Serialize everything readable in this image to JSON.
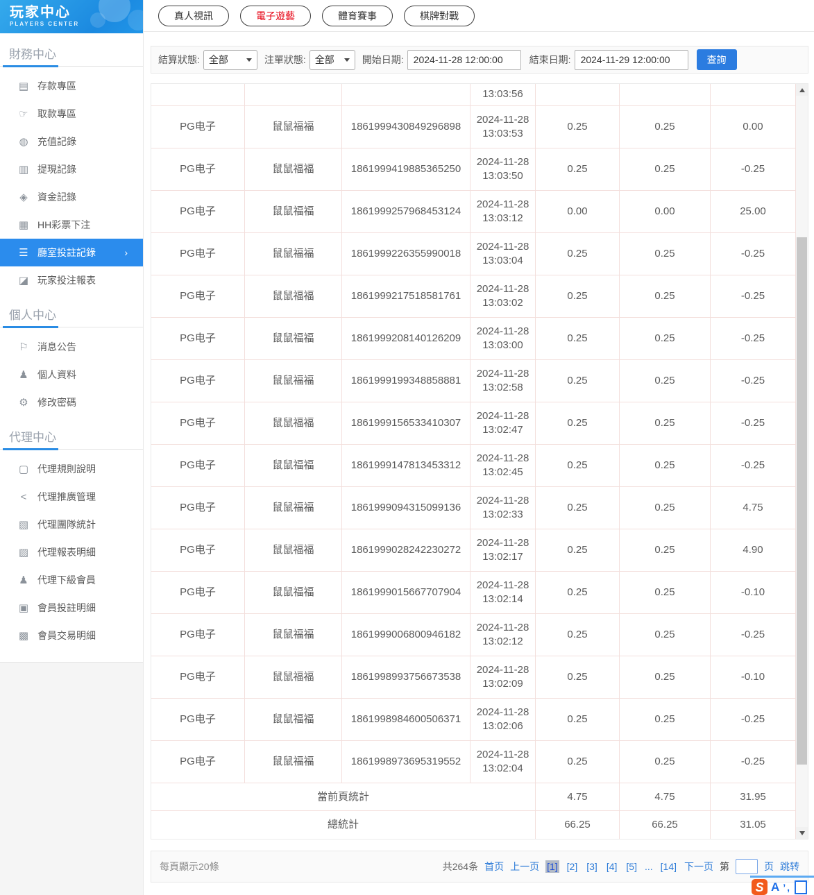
{
  "header": {
    "title": "玩家中心",
    "subtitle": "PLAYERS CENTER"
  },
  "sidebar": {
    "sections": [
      {
        "title": "財務中心",
        "items": [
          {
            "label": "存款專區",
            "icon": "deposit-icon",
            "glyph": "▤",
            "active": false
          },
          {
            "label": "取款專區",
            "icon": "withdraw-area-icon",
            "glyph": "☞",
            "active": false
          },
          {
            "label": "充值記錄",
            "icon": "recharge-record-icon",
            "glyph": "◍",
            "active": false
          },
          {
            "label": "提現記錄",
            "icon": "withdraw-record-icon",
            "glyph": "▥",
            "active": false
          },
          {
            "label": "資金記錄",
            "icon": "funds-record-icon",
            "glyph": "◈",
            "active": false
          },
          {
            "label": "HH彩票下注",
            "icon": "lottery-bet-icon",
            "glyph": "▦",
            "active": false
          },
          {
            "label": "廳室投註記錄",
            "icon": "hall-bet-record-icon",
            "glyph": "☰",
            "active": true,
            "chevron": "›"
          },
          {
            "label": "玩家投注報表",
            "icon": "player-bet-report-icon",
            "glyph": "◪",
            "active": false
          }
        ]
      },
      {
        "title": "個人中心",
        "items": [
          {
            "label": "消息公告",
            "icon": "bell-icon",
            "glyph": "⚐",
            "active": false
          },
          {
            "label": "個人資料",
            "icon": "user-icon",
            "glyph": "♟",
            "active": false
          },
          {
            "label": "修改密碼",
            "icon": "gear-icon",
            "glyph": "⚙",
            "active": false
          }
        ]
      },
      {
        "title": "代理中心",
        "items": [
          {
            "label": "代理規則說明",
            "icon": "doc-icon",
            "glyph": "▢",
            "active": false
          },
          {
            "label": "代理推廣管理",
            "icon": "share-icon",
            "glyph": "<",
            "active": false
          },
          {
            "label": "代理團隊統計",
            "icon": "team-stats-icon",
            "glyph": "▧",
            "active": false
          },
          {
            "label": "代理報表明細",
            "icon": "report-detail-icon",
            "glyph": "▨",
            "active": false
          },
          {
            "label": "代理下級會員",
            "icon": "members-icon",
            "glyph": "♟",
            "active": false
          },
          {
            "label": "會員投註明細",
            "icon": "member-bet-detail-icon",
            "glyph": "▣",
            "active": false
          },
          {
            "label": "會員交易明細",
            "icon": "member-trade-detail-icon",
            "glyph": "▩",
            "active": false
          }
        ]
      }
    ]
  },
  "tabs": [
    {
      "label": "真人視訊",
      "active": false
    },
    {
      "label": "電子遊藝",
      "active": true
    },
    {
      "label": "體育賽事",
      "active": false
    },
    {
      "label": "棋牌對戰",
      "active": false
    }
  ],
  "filters": {
    "settle_label": "結算狀態:",
    "settle_value": "全部",
    "order_label": "注單狀態:",
    "order_value": "全部",
    "start_label": "開始日期:",
    "start_value": "2024-11-28 12:00:00",
    "end_label": "結束日期:",
    "end_value": "2024-11-29 12:00:00",
    "search_label": "查詢"
  },
  "table": {
    "partial_row_time": "13:03:56",
    "rows": [
      {
        "platform": "PG电子",
        "game": "鼠鼠福福",
        "order": "1861999430849296898",
        "date": "2024-11-28",
        "time": "13:03:53",
        "bet": "0.25",
        "valid": "0.25",
        "profit": "0.00"
      },
      {
        "platform": "PG电子",
        "game": "鼠鼠福福",
        "order": "1861999419885365250",
        "date": "2024-11-28",
        "time": "13:03:50",
        "bet": "0.25",
        "valid": "0.25",
        "profit": "-0.25"
      },
      {
        "platform": "PG电子",
        "game": "鼠鼠福福",
        "order": "1861999257968453124",
        "date": "2024-11-28",
        "time": "13:03:12",
        "bet": "0.00",
        "valid": "0.00",
        "profit": "25.00"
      },
      {
        "platform": "PG电子",
        "game": "鼠鼠福福",
        "order": "1861999226355990018",
        "date": "2024-11-28",
        "time": "13:03:04",
        "bet": "0.25",
        "valid": "0.25",
        "profit": "-0.25"
      },
      {
        "platform": "PG电子",
        "game": "鼠鼠福福",
        "order": "1861999217518581761",
        "date": "2024-11-28",
        "time": "13:03:02",
        "bet": "0.25",
        "valid": "0.25",
        "profit": "-0.25"
      },
      {
        "platform": "PG电子",
        "game": "鼠鼠福福",
        "order": "1861999208140126209",
        "date": "2024-11-28",
        "time": "13:03:00",
        "bet": "0.25",
        "valid": "0.25",
        "profit": "-0.25"
      },
      {
        "platform": "PG电子",
        "game": "鼠鼠福福",
        "order": "1861999199348858881",
        "date": "2024-11-28",
        "time": "13:02:58",
        "bet": "0.25",
        "valid": "0.25",
        "profit": "-0.25"
      },
      {
        "platform": "PG电子",
        "game": "鼠鼠福福",
        "order": "1861999156533410307",
        "date": "2024-11-28",
        "time": "13:02:47",
        "bet": "0.25",
        "valid": "0.25",
        "profit": "-0.25"
      },
      {
        "platform": "PG电子",
        "game": "鼠鼠福福",
        "order": "1861999147813453312",
        "date": "2024-11-28",
        "time": "13:02:45",
        "bet": "0.25",
        "valid": "0.25",
        "profit": "-0.25"
      },
      {
        "platform": "PG电子",
        "game": "鼠鼠福福",
        "order": "1861999094315099136",
        "date": "2024-11-28",
        "time": "13:02:33",
        "bet": "0.25",
        "valid": "0.25",
        "profit": "4.75"
      },
      {
        "platform": "PG电子",
        "game": "鼠鼠福福",
        "order": "1861999028242230272",
        "date": "2024-11-28",
        "time": "13:02:17",
        "bet": "0.25",
        "valid": "0.25",
        "profit": "4.90"
      },
      {
        "platform": "PG电子",
        "game": "鼠鼠福福",
        "order": "1861999015667707904",
        "date": "2024-11-28",
        "time": "13:02:14",
        "bet": "0.25",
        "valid": "0.25",
        "profit": "-0.10"
      },
      {
        "platform": "PG电子",
        "game": "鼠鼠福福",
        "order": "1861999006800946182",
        "date": "2024-11-28",
        "time": "13:02:12",
        "bet": "0.25",
        "valid": "0.25",
        "profit": "-0.25"
      },
      {
        "platform": "PG电子",
        "game": "鼠鼠福福",
        "order": "1861998993756673538",
        "date": "2024-11-28",
        "time": "13:02:09",
        "bet": "0.25",
        "valid": "0.25",
        "profit": "-0.10"
      },
      {
        "platform": "PG电子",
        "game": "鼠鼠福福",
        "order": "1861998984600506371",
        "date": "2024-11-28",
        "time": "13:02:06",
        "bet": "0.25",
        "valid": "0.25",
        "profit": "-0.25"
      },
      {
        "platform": "PG电子",
        "game": "鼠鼠福福",
        "order": "1861998973695319552",
        "date": "2024-11-28",
        "time": "13:02:04",
        "bet": "0.25",
        "valid": "0.25",
        "profit": "-0.25"
      }
    ],
    "summary": [
      {
        "label": "當前頁統計",
        "bet": "4.75",
        "valid": "4.75",
        "profit": "31.95"
      },
      {
        "label": "總統計",
        "bet": "66.25",
        "valid": "66.25",
        "profit": "31.05"
      }
    ]
  },
  "pagination": {
    "page_size": "每頁顯示20條",
    "total": "共264条",
    "first": "首页",
    "prev": "上一页",
    "pages": [
      {
        "label": "[1]",
        "current": true
      },
      {
        "label": "[2]",
        "current": false
      },
      {
        "label": "[3]",
        "current": false
      },
      {
        "label": "[4]",
        "current": false
      },
      {
        "label": "[5]",
        "current": false
      },
      {
        "label": "...",
        "current": false,
        "ellipsis": true
      },
      {
        "label": "[14]",
        "current": false
      }
    ],
    "next": "下一页",
    "jump_prefix": "第",
    "jump_suffix": "页",
    "jump_go": "跳转"
  },
  "ime": {
    "letter": "A",
    "marks": "’,"
  },
  "colors": {
    "accent_blue": "#2b8ced",
    "tab_active_red": "#e60012",
    "table_border_pink": "#f3dfdc",
    "link_blue": "#2e7cd8"
  }
}
